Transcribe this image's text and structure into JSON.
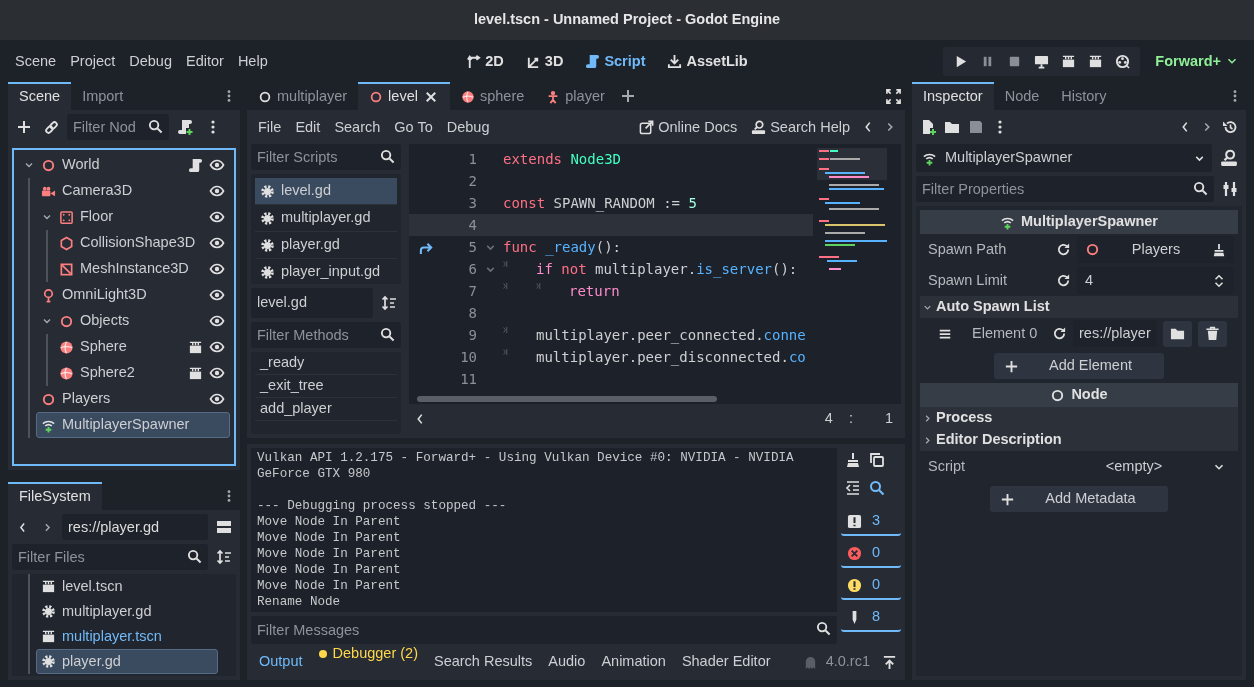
{
  "window": {
    "title": "level.tscn - Unnamed Project - Godot Engine"
  },
  "menu": [
    "Scene",
    "Project",
    "Debug",
    "Editor",
    "Help"
  ],
  "workspaces": [
    {
      "label": "2D",
      "kind": "canvas",
      "selected": false
    },
    {
      "label": "3D",
      "kind": "spatial",
      "selected": false
    },
    {
      "label": "Script",
      "kind": "script",
      "selected": true
    },
    {
      "label": "AssetLib",
      "kind": "assetlib",
      "selected": false
    }
  ],
  "renderer": "Forward+",
  "scene_dock": {
    "tabs": [
      {
        "label": "Scene",
        "selected": true
      },
      {
        "label": "Import",
        "selected": false
      }
    ],
    "filter": {
      "placeholder": "Filter Nod"
    },
    "tree": [
      {
        "name": "World",
        "kind": "node3d",
        "expanded": true,
        "selected": false,
        "script": true,
        "visibility": true,
        "children": [
          {
            "name": "Camera3D",
            "kind": "camera",
            "selected": false,
            "visibility": true
          },
          {
            "name": "Floor",
            "kind": "static_body",
            "expanded": true,
            "selected": false,
            "visibility": true,
            "children": [
              {
                "name": "CollisionShape3D",
                "kind": "collision_shape",
                "selected": false,
                "visibility": true
              },
              {
                "name": "MeshInstance3D",
                "kind": "mesh",
                "selected": false,
                "visibility": true
              }
            ]
          },
          {
            "name": "OmniLight3D",
            "kind": "light",
            "selected": false,
            "visibility": true
          },
          {
            "name": "Objects",
            "kind": "node3d",
            "expanded": true,
            "selected": false,
            "visibility": true,
            "children": [
              {
                "name": "Sphere",
                "kind": "sphere",
                "selected": false,
                "instance": true,
                "visibility": true
              },
              {
                "name": "Sphere2",
                "kind": "sphere",
                "selected": false,
                "instance": true,
                "visibility": true
              }
            ]
          },
          {
            "name": "Players",
            "kind": "node3d",
            "selected": false,
            "visibility": true
          },
          {
            "name": "MultiplayerSpawner",
            "kind": "spawner",
            "selected": true
          }
        ]
      }
    ]
  },
  "filesystem": {
    "tabs": [
      {
        "label": "FileSystem",
        "selected": true
      }
    ],
    "path": "res://player.gd",
    "filter": {
      "placeholder": "Filter Files"
    },
    "files": [
      {
        "name": "level.tscn",
        "kind": "scene",
        "selected": false,
        "main_scene": false
      },
      {
        "name": "multiplayer.gd",
        "kind": "script",
        "selected": false,
        "main_scene": false
      },
      {
        "name": "multiplayer.tscn",
        "kind": "scene",
        "selected": false,
        "main_scene": true
      },
      {
        "name": "player.gd",
        "kind": "script",
        "selected": true,
        "main_scene": false
      }
    ]
  },
  "script_tabs": [
    {
      "label": "multiplayer",
      "kind": "node",
      "selected": false
    },
    {
      "label": "level",
      "kind": "node3d",
      "selected": true
    },
    {
      "label": "sphere",
      "kind": "sphere",
      "selected": false
    },
    {
      "label": "player",
      "kind": "character",
      "selected": false
    }
  ],
  "script_menu": [
    "File",
    "Edit",
    "Search",
    "Go To",
    "Debug"
  ],
  "help_links": [
    {
      "label": "Online Docs",
      "kind": "docs"
    },
    {
      "label": "Search Help",
      "kind": "help"
    }
  ],
  "scripts_filter": {
    "placeholder": "Filter Scripts"
  },
  "scripts": [
    {
      "name": "level.gd",
      "selected": true
    },
    {
      "name": "multiplayer.gd",
      "selected": false
    },
    {
      "name": "player.gd",
      "selected": false
    },
    {
      "name": "player_input.gd",
      "selected": false
    }
  ],
  "current_script": "level.gd",
  "methods_filter": {
    "placeholder": "Filter Methods"
  },
  "methods": [
    "_ready",
    "_exit_tree",
    "add_player"
  ],
  "code": [
    {
      "number": "1",
      "selected": false,
      "tokens": [
        {
          "kind": "keyword",
          "text": "extends"
        },
        {
          "kind": "type",
          "text": " Node3D"
        }
      ]
    },
    {
      "number": "2",
      "selected": false
    },
    {
      "number": "3",
      "selected": false,
      "tokens": [
        {
          "kind": "keyword",
          "text": "const"
        },
        {
          "kind": "plain",
          "text": " SPAWN_RANDOM := "
        },
        {
          "kind": "number",
          "text": "5"
        }
      ]
    },
    {
      "number": "4",
      "selected": true
    },
    {
      "number": "5",
      "selected": false,
      "signal": true,
      "foldable": true,
      "tokens": [
        {
          "kind": "keyword",
          "text": "func"
        },
        {
          "kind": "function",
          "text": " _ready"
        },
        {
          "kind": "plain",
          "text": "():"
        }
      ]
    },
    {
      "number": "6",
      "selected": false,
      "foldable": true,
      "tokens": [
        {
          "kind": "tab"
        },
        {
          "kind": "control",
          "text": "if"
        },
        {
          "kind": "keyword",
          "text": " not"
        },
        {
          "kind": "plain",
          "text": " multiplayer."
        },
        {
          "kind": "function",
          "text": "is_server"
        },
        {
          "kind": "plain",
          "text": "():"
        }
      ]
    },
    {
      "number": "7",
      "selected": false,
      "tokens": [
        {
          "kind": "tab"
        },
        {
          "kind": "tab"
        },
        {
          "kind": "control",
          "text": "return"
        }
      ]
    },
    {
      "number": "8",
      "selected": false
    },
    {
      "number": "9",
      "selected": false,
      "tokens": [
        {
          "kind": "tab"
        },
        {
          "kind": "plain",
          "text": "multiplayer.peer_connected."
        },
        {
          "kind": "function",
          "text": "conne"
        }
      ]
    },
    {
      "number": "10",
      "selected": false,
      "tokens": [
        {
          "kind": "tab"
        },
        {
          "kind": "plain",
          "text": "multiplayer.peer_disconnected."
        },
        {
          "kind": "function",
          "text": "co"
        }
      ]
    },
    {
      "number": "11",
      "selected": false
    }
  ],
  "cursor": {
    "line": "4",
    "separator": ":",
    "column": "1"
  },
  "output": [
    {
      "text": "Vulkan API 1.2.175 - Forward+ - Using Vulkan Device #0: NVIDIA - NVIDIA"
    },
    {
      "text": "GeForce GTX 980"
    },
    {
      "text": "--- Debugging process stopped ---",
      "blank_before": true
    },
    {
      "text": "Move Node In Parent"
    },
    {
      "text": "Move Node In Parent"
    },
    {
      "text": "Move Node In Parent"
    },
    {
      "text": "Move Node In Parent"
    },
    {
      "text": "Move Node In Parent"
    },
    {
      "text": "Rename Node"
    }
  ],
  "output_filter": {
    "placeholder": "Filter Messages"
  },
  "counters": [
    {
      "kind": "message",
      "count": "3",
      "on": true
    },
    {
      "kind": "error",
      "count": "0",
      "on": true
    },
    {
      "kind": "warning",
      "count": "0",
      "on": true
    },
    {
      "kind": "editor",
      "count": "8",
      "on": true
    }
  ],
  "bottom_tabs": [
    {
      "label": "Output",
      "selected": true,
      "alert": false
    },
    {
      "label": "Debugger (2)",
      "selected": false,
      "alert": true
    },
    {
      "label": "Search Results",
      "selected": false,
      "alert": false
    },
    {
      "label": "Audio",
      "selected": false,
      "alert": false
    },
    {
      "label": "Animation",
      "selected": false,
      "alert": false
    },
    {
      "label": "Shader Editor",
      "selected": false,
      "alert": false
    }
  ],
  "version": "4.0.rc1",
  "inspector": {
    "tabs": [
      {
        "label": "Inspector",
        "selected": true
      },
      {
        "label": "Node",
        "selected": false
      },
      {
        "label": "History",
        "selected": false
      }
    ],
    "object": "MultiplayerSpawner",
    "filter": {
      "placeholder": "Filter Properties"
    },
    "sections": [
      {
        "title": "MultiplayerSpawner",
        "kind": "spawner",
        "items": [
          {
            "kind": "node_path",
            "label": "Spawn Path",
            "value": "Players"
          },
          {
            "kind": "spin",
            "label": "Spawn Limit",
            "value": "4"
          },
          {
            "kind": "array",
            "title": "Auto Spawn List",
            "expanded": true,
            "elements": [
              {
                "label": "Element 0",
                "value": "res://player"
              }
            ],
            "add_label": "Add Element"
          }
        ]
      },
      {
        "title": "Node",
        "kind": "node",
        "items": [
          {
            "kind": "group",
            "title": "Process",
            "expanded": false
          },
          {
            "kind": "group",
            "title": "Editor Description",
            "expanded": false
          },
          {
            "kind": "resource",
            "label": "Script",
            "value": "<empty>"
          }
        ]
      }
    ],
    "add_metadata": "Add Metadata"
  }
}
